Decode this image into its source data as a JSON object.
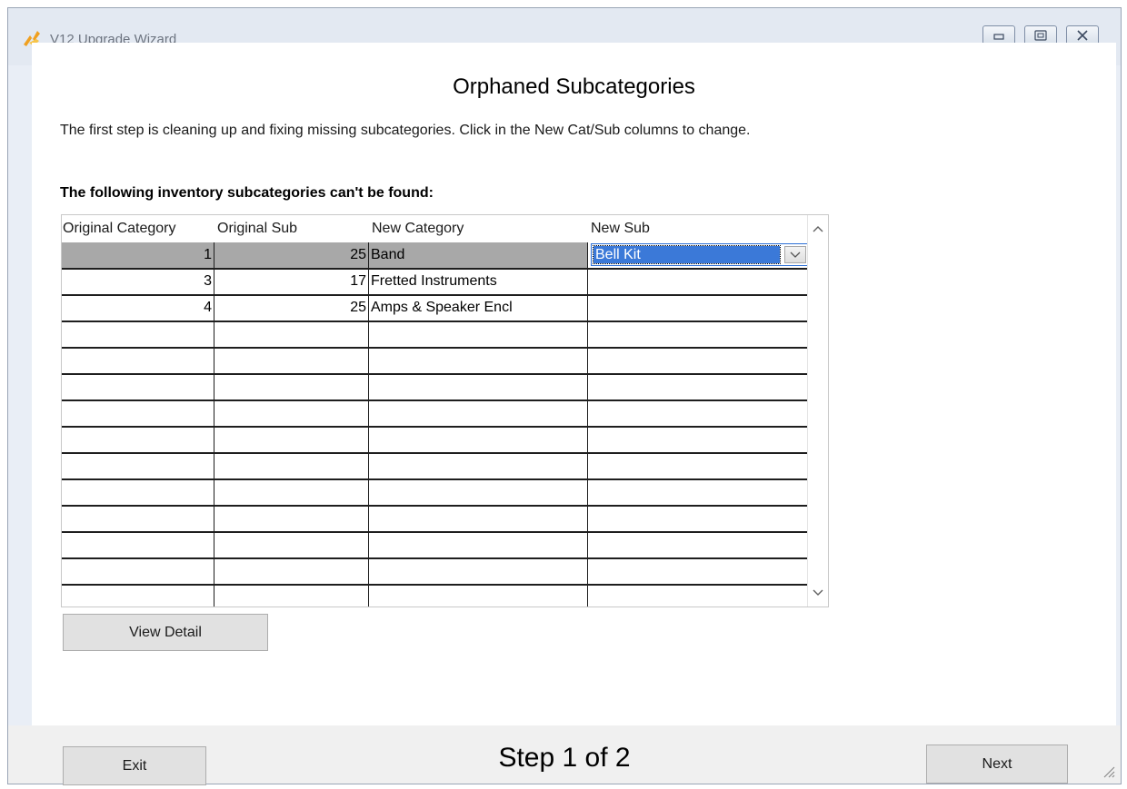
{
  "window": {
    "title": "V12 Upgrade Wizard",
    "icon": "app-wizard-icon",
    "controls": [
      "minimize-icon",
      "maximize-icon",
      "close-icon"
    ]
  },
  "page": {
    "title": "Orphaned Subcategories",
    "intro": "The first step is cleaning up and fixing missing subcategories.  Click in the New Cat/Sub columns to change.",
    "section_label": "The following inventory subcategories can't be found:"
  },
  "grid": {
    "headers": [
      "Original Category",
      "Original Sub",
      "New Category",
      "New Sub"
    ],
    "rows": [
      {
        "original_category": "1",
        "original_sub": "25",
        "new_category": "Band",
        "new_sub": "Bell Kit",
        "selected": true
      },
      {
        "original_category": "3",
        "original_sub": "17",
        "new_category": "Fretted Instruments",
        "new_sub": ""
      },
      {
        "original_category": "4",
        "original_sub": "25",
        "new_category": "Amps & Speaker Encl",
        "new_sub": ""
      },
      {
        "original_category": "",
        "original_sub": "",
        "new_category": "",
        "new_sub": ""
      },
      {
        "original_category": "",
        "original_sub": "",
        "new_category": "",
        "new_sub": ""
      },
      {
        "original_category": "",
        "original_sub": "",
        "new_category": "",
        "new_sub": ""
      },
      {
        "original_category": "",
        "original_sub": "",
        "new_category": "",
        "new_sub": ""
      },
      {
        "original_category": "",
        "original_sub": "",
        "new_category": "",
        "new_sub": ""
      },
      {
        "original_category": "",
        "original_sub": "",
        "new_category": "",
        "new_sub": ""
      },
      {
        "original_category": "",
        "original_sub": "",
        "new_category": "",
        "new_sub": ""
      },
      {
        "original_category": "",
        "original_sub": "",
        "new_category": "",
        "new_sub": ""
      },
      {
        "original_category": "",
        "original_sub": "",
        "new_category": "",
        "new_sub": ""
      },
      {
        "original_category": "",
        "original_sub": "",
        "new_category": "",
        "new_sub": ""
      },
      {
        "original_category": "",
        "original_sub": "",
        "new_category": "",
        "new_sub": ""
      }
    ]
  },
  "buttons": {
    "view_detail": "View Detail",
    "exit": "Exit",
    "next": "Next"
  },
  "footer": {
    "step": "Step 1 of 2"
  },
  "colors": {
    "selection": "#3b79d8",
    "selected_row": "#a8a8a8",
    "button_face": "#e1e1e1"
  }
}
